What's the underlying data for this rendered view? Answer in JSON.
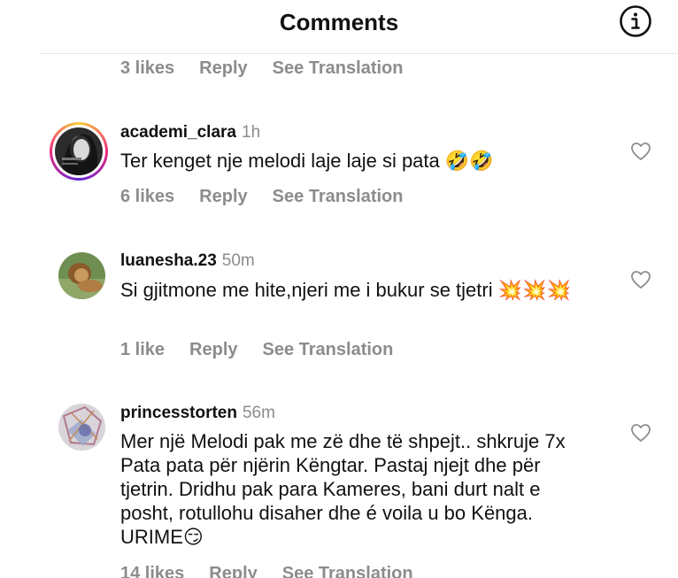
{
  "header": {
    "title": "Comments",
    "info_icon": "info-icon"
  },
  "partial_comment": {
    "likes": "3 likes",
    "reply": "Reply",
    "translate": "See Translation"
  },
  "comments": [
    {
      "username": "academi_clara",
      "time": "1h",
      "text": "Ter kenget nje melodi laje laje si pata 🤣🤣",
      "likes": "6 likes",
      "reply": "Reply",
      "translate": "See Translation",
      "has_story_ring": true,
      "heart_icon": "heart-outline-icon"
    },
    {
      "username": "luanesha.23",
      "time": "50m",
      "text": "Si gjitmone me hite,njeri me i bukur se tjetri 💥💥💥",
      "likes": "1 like",
      "reply": "Reply",
      "translate": "See Translation",
      "has_story_ring": false,
      "heart_icon": "heart-outline-icon"
    },
    {
      "username": "princesstorten",
      "time": "56m",
      "text": "Mer një Melodi pak me zë dhe të shpejt.. shkruje 7x Pata pata për njërin Këngtar. Pastaj njejt dhe për tjetrin. Dridhu pak para Kameres, bani durt nalt e posht, rotullohu disaher dhe  é voila u bo Kënga.  URIME😏",
      "likes": "14 likes",
      "reply": "Reply",
      "translate": "See Translation",
      "has_story_ring": false,
      "heart_icon": "heart-outline-icon"
    }
  ]
}
